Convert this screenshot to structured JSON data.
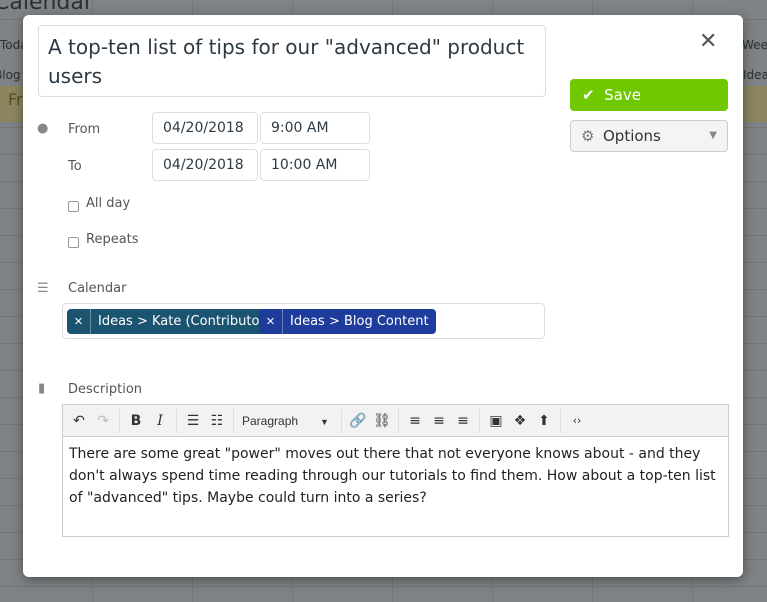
{
  "background": {
    "title": "Calendar",
    "today": "Today",
    "week": "Week",
    "blog": "Blog C",
    "ideas": "Ideas",
    "fr": "Fr"
  },
  "event": {
    "title": "A top-ten list of tips for our \"advanced\" product users"
  },
  "actions": {
    "save": "Save",
    "options": "Options",
    "save_color": "#6fc800"
  },
  "when": {
    "from_label": "From",
    "to_label": "To",
    "from_date": "04/20/2018",
    "from_time": "9:00 AM",
    "to_date": "04/20/2018",
    "to_time": "10:00 AM",
    "all_day": "All day",
    "repeats": "Repeats"
  },
  "calendar": {
    "label": "Calendar",
    "tags": [
      {
        "label": "Ideas > Kate (Contributor)",
        "color": "#1b5471"
      },
      {
        "label": "Ideas > Blog Content",
        "color": "#1e3c9b"
      }
    ]
  },
  "description": {
    "label": "Description",
    "format": "Paragraph",
    "text": "There are some great \"power\" moves out there that not everyone knows about - and they don't always spend time reading through our tutorials to find them. How about a top-ten list of \"advanced\" tips. Maybe could turn into a series?"
  }
}
